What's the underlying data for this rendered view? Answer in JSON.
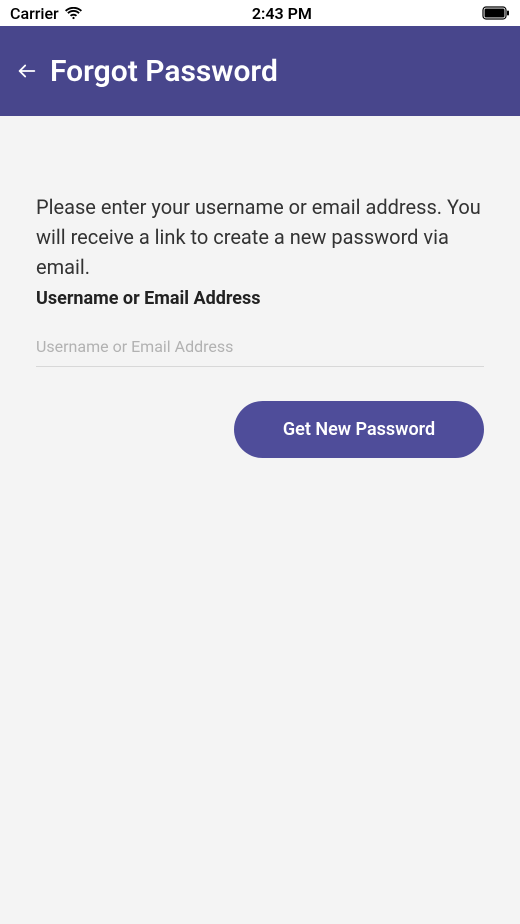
{
  "statusBar": {
    "carrier": "Carrier",
    "time": "2:43 PM"
  },
  "header": {
    "title": "Forgot Password"
  },
  "content": {
    "instructions": "Please enter your username or email address. You will receive a link to create a new password via email.",
    "fieldLabel": "Username or Email Address",
    "inputPlaceholder": "Username or Email Address",
    "buttonLabel": "Get New Password"
  }
}
